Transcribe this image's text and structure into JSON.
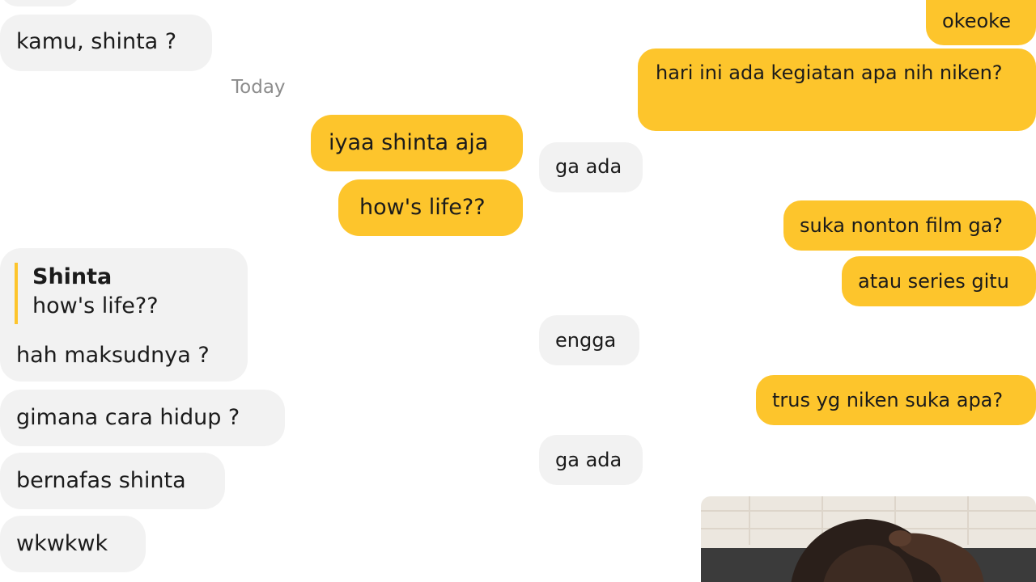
{
  "left_chat": {
    "messages": [
      {
        "text": "kamu, shinta ?"
      },
      {
        "text": "iyaa shinta aja"
      },
      {
        "text": "how's life??"
      },
      {
        "quote_name": "Shinta",
        "quote_text": "how's life??",
        "text": "hah maksudnya ?"
      },
      {
        "text": "gimana cara hidup ?"
      },
      {
        "text": "bernafas shinta"
      },
      {
        "text": "wkwkwk"
      }
    ],
    "date_separator": "Today"
  },
  "right_chat": {
    "messages": [
      {
        "text": "okeoke"
      },
      {
        "text": "hari ini ada kegiatan apa nih niken?"
      },
      {
        "text": "ga ada"
      },
      {
        "text": "suka nonton film ga?"
      },
      {
        "text": "atau series gitu"
      },
      {
        "text": "engga"
      },
      {
        "text": "trus yg niken suka apa?"
      },
      {
        "text": "ga ada"
      }
    ],
    "media_icon": "photo-face-palm-icon"
  },
  "colors": {
    "outgoing_bubble": "#fdc52c",
    "incoming_bubble": "#f2f2f2",
    "timestamp": "#8c8c8c"
  }
}
